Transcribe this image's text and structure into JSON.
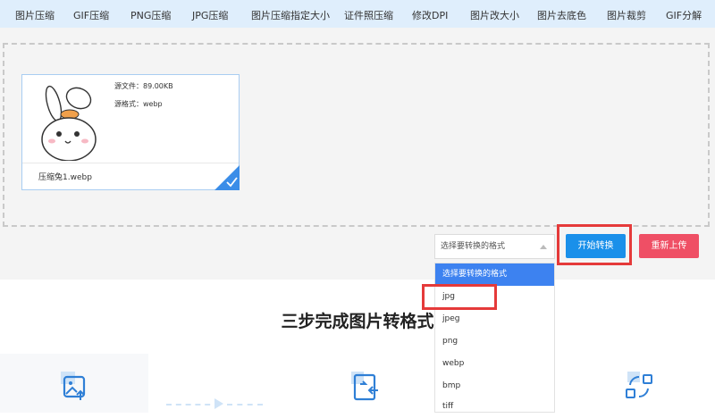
{
  "nav": {
    "items": [
      "图片压缩",
      "GIF压缩",
      "PNG压缩",
      "JPG压缩",
      "图片压缩指定大小",
      "证件照压缩",
      "修改DPI",
      "图片改大小",
      "图片去底色",
      "图片裁剪",
      "GIF分解"
    ]
  },
  "file": {
    "size_label": "源文件：89.00KB",
    "format_label": "源格式：webp",
    "name": "压缩兔1.webp"
  },
  "format_select": {
    "placeholder": "选择要转换的格式",
    "options": [
      "选择要转换的格式",
      "jpg",
      "jpeg",
      "png",
      "webp",
      "bmp",
      "tiff"
    ],
    "highlighted_index": 0
  },
  "buttons": {
    "start": "开始转换",
    "reupload": "重新上传"
  },
  "section": {
    "heading": "三步完成图片转格式"
  },
  "colors": {
    "nav_bg": "#dfeefc",
    "primary": "#1a90ea",
    "danger": "#ef4f65",
    "highlight_box": "#e53a3a",
    "dropdown_active": "#3d82f0"
  }
}
